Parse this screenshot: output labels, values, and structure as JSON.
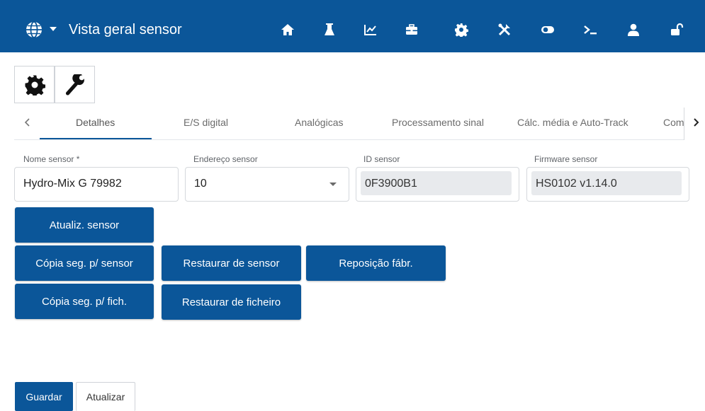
{
  "header": {
    "title": "Vista geral sensor",
    "menu_icon": "globe-icon",
    "nav_icons": [
      "home-icon",
      "flask-icon",
      "chart-icon",
      "toolbox-icon",
      "gear-icon",
      "tools-icon",
      "toggle-icon",
      "terminal-icon",
      "user-icon",
      "unlock-icon"
    ],
    "bar_color": "#0b5699"
  },
  "toolbar": {
    "icons": [
      "gear-icon",
      "wrench-icon"
    ]
  },
  "tabs": {
    "items": [
      {
        "label": "Detalhes",
        "active": true
      },
      {
        "label": "E/S digital",
        "active": false
      },
      {
        "label": "Analógicas",
        "active": false
      },
      {
        "label": "Processamento sinal",
        "active": false
      },
      {
        "label": "Cálc. média e Auto-Track",
        "active": false
      },
      {
        "label": "Com",
        "active": false
      }
    ]
  },
  "fields": {
    "name": {
      "label": "Nome sensor *",
      "value": "Hydro-Mix G 79982"
    },
    "address": {
      "label": "Endereço sensor",
      "value": "10"
    },
    "id": {
      "label": "ID sensor",
      "value": "0F3900B1"
    },
    "firmware": {
      "label": "Firmware sensor",
      "value": "HS0102 v1.14.0"
    }
  },
  "actions": {
    "update_sensor": "Atualiz. sensor",
    "backup_to_sensor": "Cópia seg. p/ sensor",
    "restore_from_sensor": "Restaurar de sensor",
    "factory_reset": "Reposição fábr.",
    "backup_to_file": "Cópia seg. p/ fich.",
    "restore_from_file": "Restaurar de ficheiro"
  },
  "footer": {
    "save": "Guardar",
    "refresh": "Atualizar"
  }
}
